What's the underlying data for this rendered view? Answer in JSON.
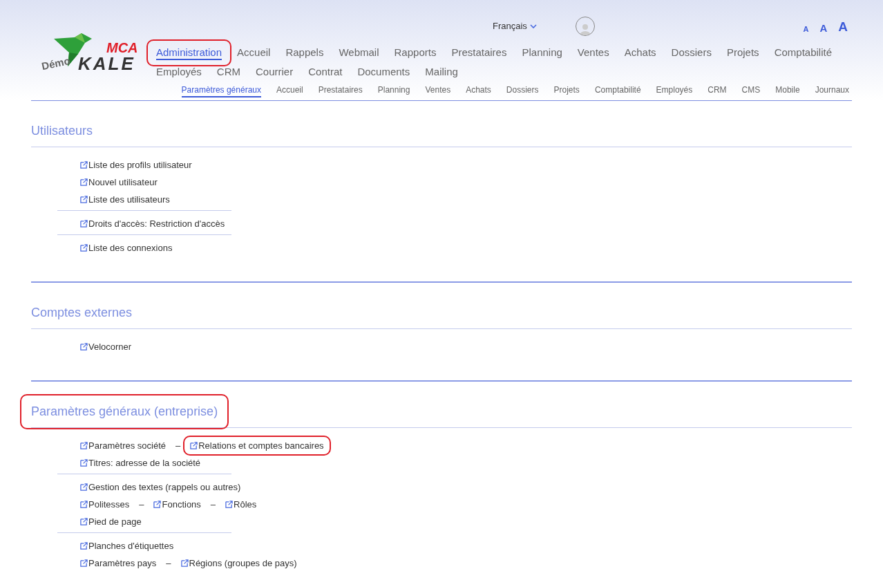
{
  "logo": {
    "prefix": "Démo",
    "brand": "KALE",
    "badge": "MCA"
  },
  "language": {
    "label": "Français"
  },
  "font_sizes": [
    "A",
    "A",
    "A"
  ],
  "main_nav": [
    {
      "label": "Administration",
      "selected": true,
      "highlighted": true
    },
    {
      "label": "Accueil",
      "selected": false,
      "highlighted": false
    },
    {
      "label": "Rappels",
      "selected": false,
      "highlighted": false
    },
    {
      "label": "Webmail",
      "selected": false,
      "highlighted": false
    },
    {
      "label": "Rapports",
      "selected": false,
      "highlighted": false
    },
    {
      "label": "Prestataires",
      "selected": false,
      "highlighted": false
    },
    {
      "label": "Planning",
      "selected": false,
      "highlighted": false
    },
    {
      "label": "Ventes",
      "selected": false,
      "highlighted": false
    },
    {
      "label": "Achats",
      "selected": false,
      "highlighted": false
    },
    {
      "label": "Dossiers",
      "selected": false,
      "highlighted": false
    },
    {
      "label": "Projets",
      "selected": false,
      "highlighted": false
    },
    {
      "label": "Comptabilité",
      "selected": false,
      "highlighted": false
    },
    {
      "label": "Employés",
      "selected": false,
      "highlighted": false
    },
    {
      "label": "CRM",
      "selected": false,
      "highlighted": false
    },
    {
      "label": "Courrier",
      "selected": false,
      "highlighted": false
    },
    {
      "label": "Contrat",
      "selected": false,
      "highlighted": false
    },
    {
      "label": "Documents",
      "selected": false,
      "highlighted": false
    },
    {
      "label": "Mailing",
      "selected": false,
      "highlighted": false
    }
  ],
  "sub_nav": [
    {
      "label": "Paramètres généraux",
      "selected": true
    },
    {
      "label": "Accueil",
      "selected": false
    },
    {
      "label": "Prestataires",
      "selected": false
    },
    {
      "label": "Planning",
      "selected": false
    },
    {
      "label": "Ventes",
      "selected": false
    },
    {
      "label": "Achats",
      "selected": false
    },
    {
      "label": "Dossiers",
      "selected": false
    },
    {
      "label": "Projets",
      "selected": false
    },
    {
      "label": "Comptabilité",
      "selected": false
    },
    {
      "label": "Employés",
      "selected": false
    },
    {
      "label": "CRM",
      "selected": false
    },
    {
      "label": "CMS",
      "selected": false
    },
    {
      "label": "Mobile",
      "selected": false
    },
    {
      "label": "Journaux",
      "selected": false
    }
  ],
  "sections": [
    {
      "title": "Utilisateurs",
      "highlighted": false,
      "groups": [
        [
          {
            "links": [
              {
                "label": "Liste des profils utilisateur",
                "highlighted": false
              }
            ]
          },
          {
            "links": [
              {
                "label": "Nouvel utilisateur",
                "highlighted": false
              }
            ]
          },
          {
            "links": [
              {
                "label": "Liste des utilisateurs",
                "highlighted": false
              }
            ]
          }
        ],
        [
          {
            "links": [
              {
                "label": "Droits d'accès: Restriction d'accès",
                "highlighted": false
              }
            ]
          }
        ],
        [
          {
            "links": [
              {
                "label": "Liste des connexions",
                "highlighted": false
              }
            ]
          }
        ]
      ]
    },
    {
      "title": "Comptes externes",
      "highlighted": false,
      "groups": [
        [
          {
            "links": [
              {
                "label": "Velocorner",
                "highlighted": false
              }
            ]
          }
        ]
      ]
    },
    {
      "title": "Paramètres généraux (entreprise)",
      "highlighted": true,
      "groups": [
        [
          {
            "separator": "–",
            "links": [
              {
                "label": "Paramètres société",
                "highlighted": false
              },
              {
                "label": "Relations et comptes bancaires",
                "highlighted": true
              }
            ]
          },
          {
            "links": [
              {
                "label": "Titres: adresse de la société",
                "highlighted": false
              }
            ]
          }
        ],
        [
          {
            "links": [
              {
                "label": "Gestion des textes (rappels ou autres)",
                "highlighted": false
              }
            ]
          },
          {
            "separator": "–",
            "links": [
              {
                "label": "Politesses",
                "highlighted": false
              },
              {
                "label": "Fonctions",
                "highlighted": false
              },
              {
                "label": "Rôles",
                "highlighted": false
              }
            ]
          },
          {
            "links": [
              {
                "label": "Pied de page",
                "highlighted": false
              }
            ]
          }
        ],
        [
          {
            "links": [
              {
                "label": "Planches d'étiquettes",
                "highlighted": false
              }
            ]
          },
          {
            "separator": "–",
            "links": [
              {
                "label": "Paramètres pays",
                "highlighted": false
              },
              {
                "label": "Régions (groupes de pays)",
                "highlighted": false
              }
            ]
          }
        ]
      ]
    }
  ]
}
